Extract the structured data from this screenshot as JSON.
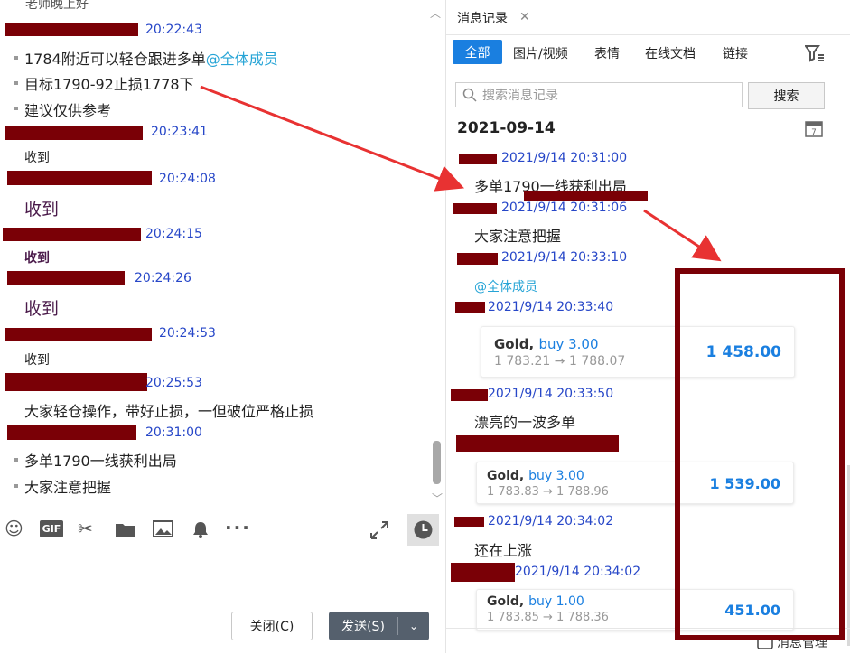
{
  "left_panel": {
    "top_cut_text": "老师晚上好",
    "messages": [
      {
        "time": "20:22:43",
        "lines": [
          "1784附近可以轻仓跟进多单",
          "目标1790-92止损1778下",
          "建议仅供参考"
        ],
        "mention": "@全体成员"
      },
      {
        "time": "20:23:41",
        "lines": [
          "收到"
        ]
      },
      {
        "time": "20:24:08",
        "lines": [
          "收到"
        ]
      },
      {
        "time": "20:24:15",
        "lines": [
          "收到"
        ]
      },
      {
        "time": "20:24:26",
        "lines": [
          "收到"
        ]
      },
      {
        "time": "20:24:53",
        "lines": [
          "收到"
        ]
      },
      {
        "time": "20:25:53",
        "lines": [
          "大家轻仓操作，带好止损，一但破位严格止损"
        ]
      },
      {
        "time": "20:31:00",
        "lines": [
          "多单1790一线获利出局",
          "大家注意把握"
        ]
      }
    ],
    "toolbar_icons": [
      "emoji-icon",
      "gif-icon",
      "scissors-icon",
      "folder-icon",
      "image-icon",
      "bell-icon",
      "more-icon"
    ],
    "gif_label": "GIF",
    "buttons": {
      "close": "关闭(C)",
      "send": "发送(S)"
    }
  },
  "right_panel": {
    "tab_title": "消息记录",
    "filters": [
      "全部",
      "图片/视频",
      "表情",
      "在线文档",
      "链接"
    ],
    "active_filter": "全部",
    "search_placeholder": "搜索消息记录",
    "search_button": "搜索",
    "date": "2021-09-14",
    "calendar_day": "7",
    "records": [
      {
        "time": "2021/9/14 20:31:00",
        "text": "多单1790一线获利出局"
      },
      {
        "time": "2021/9/14 20:31:06",
        "text": "大家注意把握"
      },
      {
        "time": "2021/9/14 20:33:10",
        "text": "@全体成员"
      },
      {
        "time": "2021/9/14 20:33:40",
        "card": {
          "asset": "Gold,",
          "side": "buy 3.00",
          "route": "1 783.21 → 1 788.07",
          "pnl": "1 458.00"
        }
      },
      {
        "time": "2021/9/14 20:33:50",
        "text": "漂亮的一波多单",
        "card": {
          "asset": "Gold,",
          "side": "buy 3.00",
          "route": "1 783.83 → 1 788.96",
          "pnl": "1 539.00"
        }
      },
      {
        "time": "2021/9/14 20:34:02",
        "text": "还在上涨"
      },
      {
        "time": "2021/9/14 20:34:02",
        "card": {
          "asset": "Gold,",
          "side": "buy 1.00",
          "route": "1 783.85 → 1 788.36",
          "pnl": "451.00"
        }
      }
    ],
    "bottom_label": "消息管理"
  },
  "colors": {
    "accent": "#1a7fe0",
    "redaction": "#7a0006",
    "timestamp": "#2747c8",
    "mention": "#26a4d6"
  }
}
